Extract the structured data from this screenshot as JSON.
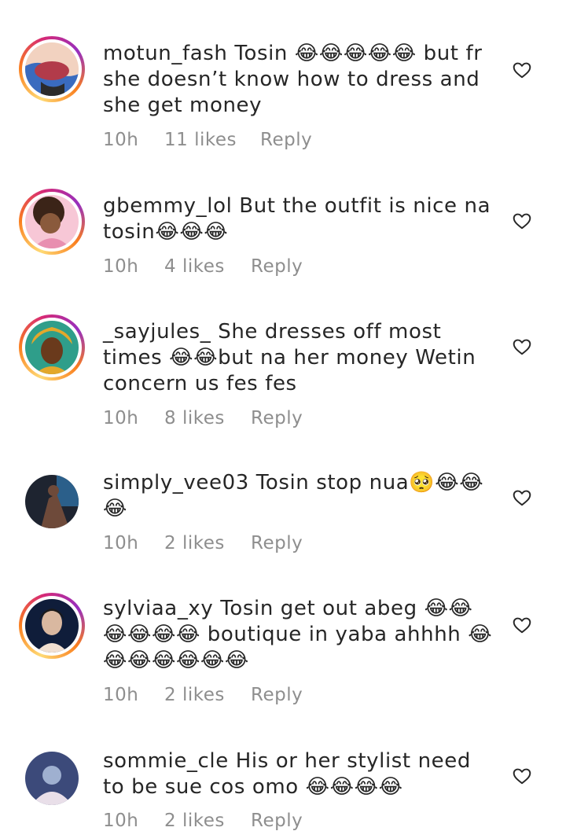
{
  "comments": [
    {
      "username": "motun_fash",
      "text": "Tosin 😂😂😂😂😂 but fr she doesn’t know how to dress and she get money",
      "time": "10h",
      "likes": "11 likes",
      "reply": "Reply",
      "avatar_ring": "story",
      "avatar_colors": [
        "#b23b4a",
        "#3a6bbf",
        "#f2d2c0"
      ]
    },
    {
      "username": "gbemmy_lol",
      "text": "But the outfit is nice na tosin😂😂😂",
      "time": "10h",
      "likes": "4 likes",
      "reply": "Reply",
      "avatar_ring": "story",
      "avatar_colors": [
        "#3b2418",
        "#e88fb0",
        "#f7c7d6"
      ]
    },
    {
      "username": "_sayjules_",
      "text": "She dresses off most times 😂😂but na her money Wetin concern us fes fes",
      "time": "10h",
      "likes": "8 likes",
      "reply": "Reply",
      "avatar_ring": "story",
      "avatar_colors": [
        "#e3a82b",
        "#6a3a1c",
        "#2f9e8a"
      ]
    },
    {
      "username": "simply_vee03",
      "text": "Tosin stop nua🥺😂😂😂",
      "time": "10h",
      "likes": "2 likes",
      "reply": "Reply",
      "avatar_ring": "none",
      "avatar_colors": [
        "#1e2430",
        "#6e4a3a",
        "#2b5f8a"
      ]
    },
    {
      "username": "sylviaa_xy",
      "text": "Tosin get out abeg 😂😂😂😂😂😂 boutique in yaba ahhhh 😂😂😂😂😂😂😂",
      "time": "10h",
      "likes": "2 likes",
      "reply": "Reply",
      "avatar_ring": "story",
      "avatar_colors": [
        "#0f1d3a",
        "#d9b8a0",
        "#f1e0d2"
      ]
    },
    {
      "username": "sommie_cle",
      "text": "His or her stylist need to be sue cos omo 😂😂😂😂",
      "time": "10h",
      "likes": "2 likes",
      "reply": "Reply",
      "avatar_ring": "none",
      "avatar_colors": [
        "#3c4a7a",
        "#e9dfe9",
        "#9fb0d0"
      ]
    }
  ],
  "icons": {
    "like": "heart-outline-icon"
  },
  "colors": {
    "meta_text": "#8e8e8e",
    "primary_text": "#262626",
    "heart_stroke": "#262626"
  }
}
